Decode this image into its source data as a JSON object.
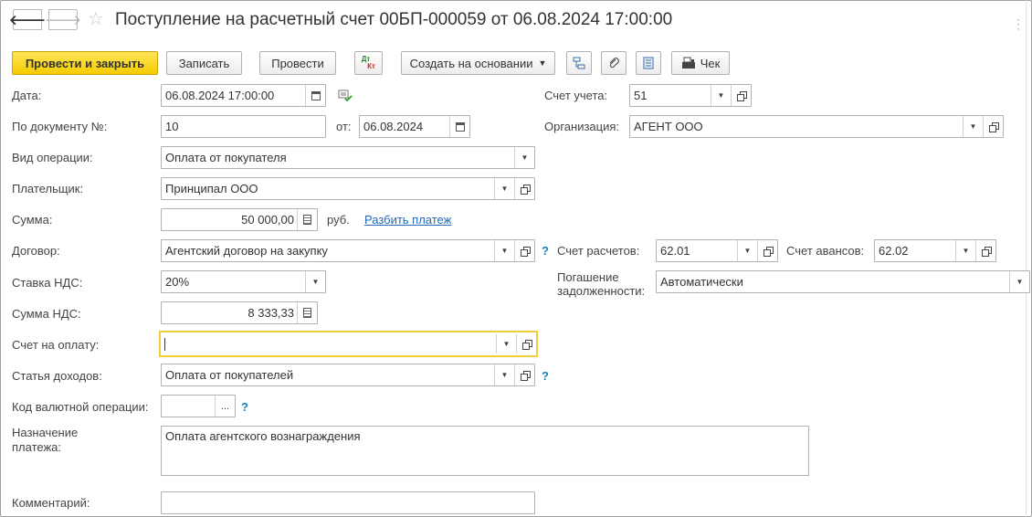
{
  "header": {
    "title": "Поступление на расчетный счет 00БП-000059 от 06.08.2024 17:00:00",
    "back_glyph": "🡐",
    "fwd_glyph": "🡒",
    "star_glyph": "☆",
    "more_glyph": "⋮"
  },
  "toolbar": {
    "post_and_close": "Провести и закрыть",
    "save": "Записать",
    "post": "Провести",
    "dtkt_dt": "Дт",
    "dtkt_kt": "Кт",
    "create_based_on": "Создать на основании",
    "receipt": "Чек"
  },
  "fields": {
    "date": {
      "label": "Дата:",
      "value": "06.08.2024 17:00:00"
    },
    "doc_number": {
      "label": "По документу №:",
      "value": "10"
    },
    "doc_from": {
      "label": "от:",
      "value": "06.08.2024"
    },
    "operation_type": {
      "label": "Вид операции:",
      "value": "Оплата от покупателя"
    },
    "payer": {
      "label": "Плательщик:",
      "value": "Принципал ООО"
    },
    "amount": {
      "label": "Сумма:",
      "value": "50 000,00",
      "currency": "руб.",
      "split_link": "Разбить платеж"
    },
    "contract": {
      "label": "Договор:",
      "value": "Агентский договор на закупку"
    },
    "vat_rate": {
      "label": "Ставка НДС:",
      "value": "20%"
    },
    "vat_amount": {
      "label": "Сумма НДС:",
      "value": "8 333,33"
    },
    "invoice": {
      "label": "Счет на оплату:",
      "value": ""
    },
    "income_item": {
      "label": "Статья доходов:",
      "value": "Оплата от покупателей"
    },
    "currency_op_code": {
      "label": "Код валютной операции:",
      "value": "",
      "select_glyph": "..."
    },
    "purpose": {
      "label_line1": "Назначение",
      "label_line2": "платежа:",
      "value": "Оплата агентского вознаграждения"
    },
    "comment": {
      "label": "Комментарий:",
      "value": ""
    },
    "account": {
      "label": "Счет учета:",
      "value": "51"
    },
    "organization": {
      "label": "Организация:",
      "value": "АГЕНТ ООО"
    },
    "settlement_account": {
      "label": "Счет расчетов:",
      "value": "62.01"
    },
    "advance_account": {
      "label": "Счет авансов:",
      "value": "62.02"
    },
    "debt_repayment": {
      "label_line1": "Погашение",
      "label_line2": "задолженности:",
      "value": "Автоматически"
    }
  },
  "help_glyph": "?",
  "dropdown_glyph": "▼",
  "colors": {
    "primary": "#f5cd00",
    "focus": "#f2cd3a",
    "link": "#2468b8",
    "help": "#1a7fc0"
  }
}
